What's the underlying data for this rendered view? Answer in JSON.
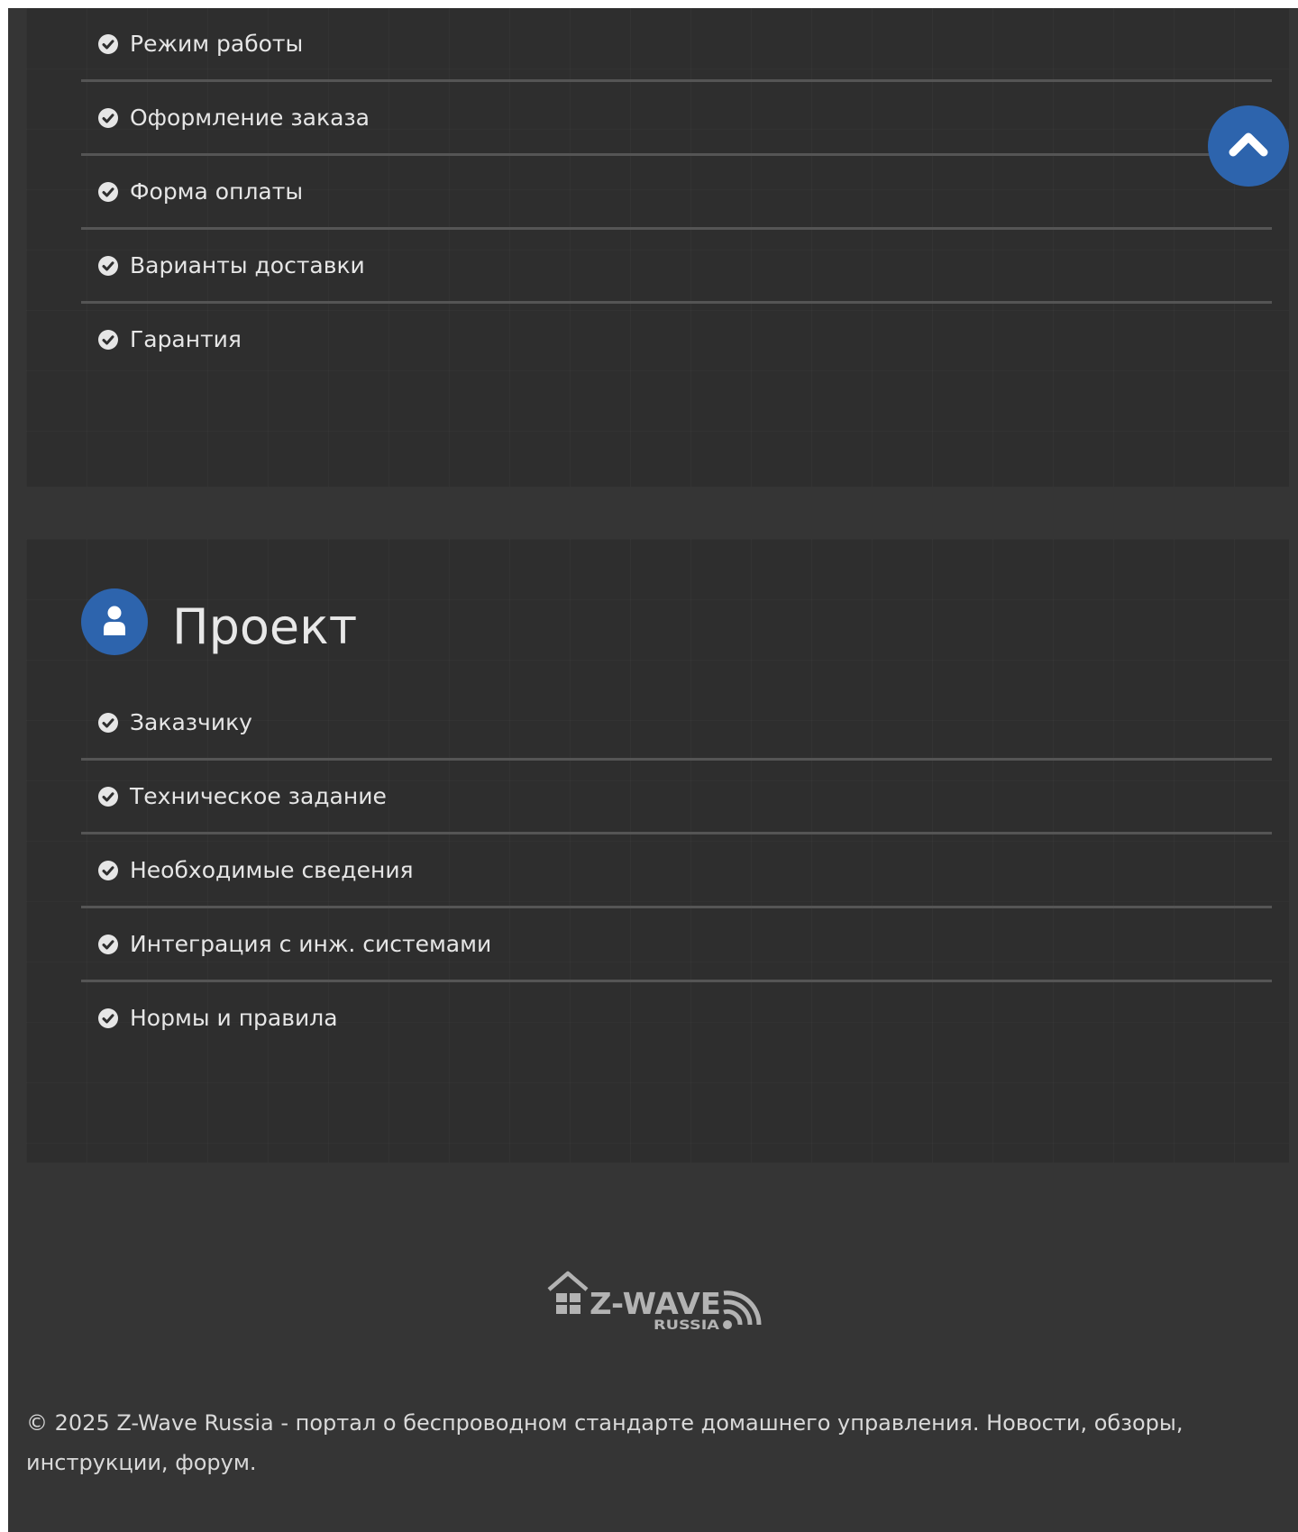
{
  "delivery_section": {
    "items": [
      {
        "label": "Режим работы"
      },
      {
        "label": "Оформление заказа"
      },
      {
        "label": "Форма оплаты"
      },
      {
        "label": "Варианты доставки"
      },
      {
        "label": "Гарантия"
      }
    ]
  },
  "project_section": {
    "title": "Проект",
    "icon": "user-icon",
    "items": [
      {
        "label": "Заказчику"
      },
      {
        "label": "Техническое задание"
      },
      {
        "label": "Необходимые сведения"
      },
      {
        "label": "Интеграция с инж. системами"
      },
      {
        "label": "Нормы и правила"
      }
    ]
  },
  "scroll_top_button": {
    "icon": "chevron-up-icon"
  },
  "footer": {
    "logo": {
      "text": "Z-WAVE",
      "subtext": "RUSSIA"
    },
    "copyright": "© 2025 Z-Wave Russia - портал о беспроводном стандарте домашнего управления. Новости, обзоры, инструкции, форум."
  },
  "colors": {
    "page_background": "#353535",
    "panel_background": "#2e2e2e",
    "accent": "#2d64ad",
    "text": "#e6e6e6",
    "divider": "#555555",
    "logo": "#b3b3b3"
  }
}
